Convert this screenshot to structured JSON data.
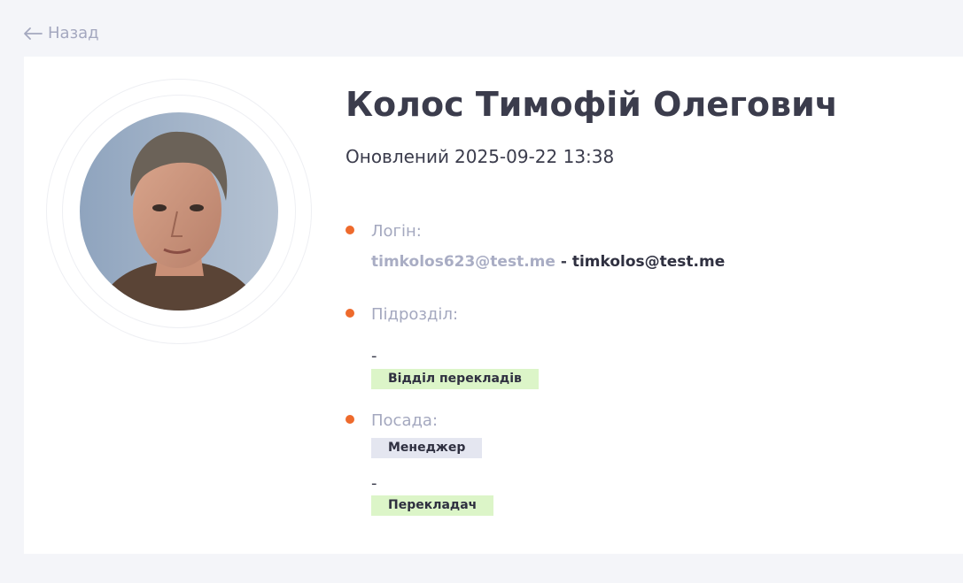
{
  "nav": {
    "back_label": "Назад"
  },
  "profile": {
    "name": "Колос Тимофій Олегович",
    "updated_label": "Оновлений",
    "updated_value": "2025-09-22 13:38"
  },
  "fields": {
    "login": {
      "label": "Логін:",
      "primary": "timkolos623@test.me",
      "separator": " - ",
      "secondary": "timkolos@test.me"
    },
    "department": {
      "label": "Підрозділ:",
      "value_prefix": "-",
      "tag": "Відділ перекладів"
    },
    "position": {
      "label": "Посада:",
      "tag_primary": "Менеджер",
      "value_prefix": "-",
      "tag_secondary": "Перекладач"
    }
  },
  "colors": {
    "background": "#f4f5f9",
    "card": "#ffffff",
    "accent_dot": "#ee6a2c",
    "muted_text": "#a4a8bf",
    "tag_green": "#dcf5c8",
    "tag_grey": "#e4e6f0"
  },
  "icons": {
    "back": "arrow-left-icon"
  }
}
